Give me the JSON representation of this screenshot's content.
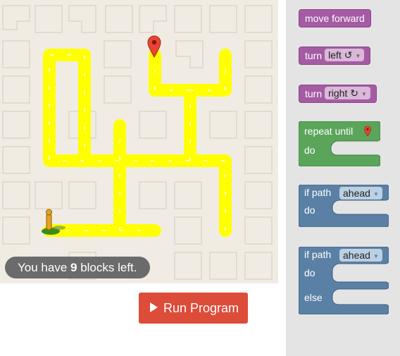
{
  "maze": {
    "start_icon": "pegman-icon",
    "goal_icon": "map-marker-icon"
  },
  "status": {
    "prefix": "You have ",
    "count": "9",
    "suffix": " blocks left."
  },
  "run_button": {
    "label": "Run Program",
    "icon": "play-icon"
  },
  "toolbox": {
    "move_forward": "move forward",
    "turn_left": {
      "text": "turn",
      "option": "left ↺"
    },
    "turn_right": {
      "text": "turn",
      "option": "right ↻"
    },
    "repeat_until": {
      "text": "repeat until",
      "icon": "map-marker-icon",
      "do": "do"
    },
    "if_path": {
      "text": "if path",
      "option": "ahead",
      "do": "do"
    },
    "if_else": {
      "text": "if path",
      "option": "ahead",
      "do": "do",
      "else": "else"
    }
  },
  "colors": {
    "path": "#ffff00",
    "run_button": "#dd4b39",
    "motion_block": "#a55ba3",
    "loop_block": "#5ba55b",
    "logic_block": "#5b80a5",
    "status_bg": "#6b6b6b"
  }
}
